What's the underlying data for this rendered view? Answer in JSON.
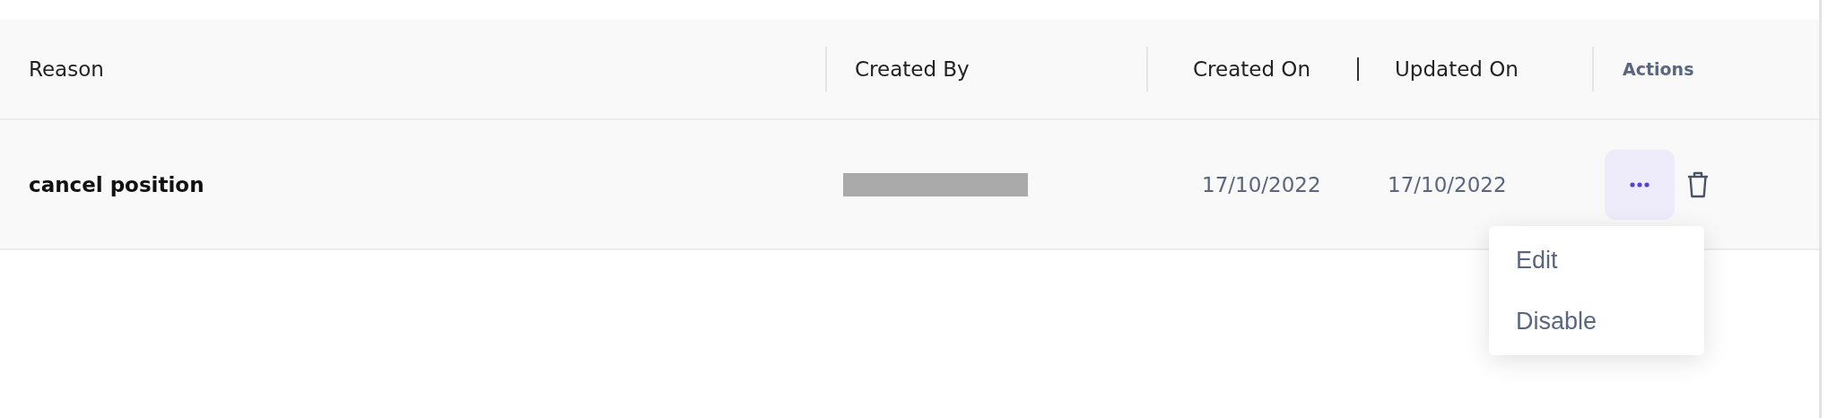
{
  "table": {
    "columns": [
      {
        "label": "Reason",
        "kind": "text"
      },
      {
        "label": "Created By",
        "kind": "text"
      },
      {
        "label": "Created On",
        "kind": "date"
      },
      {
        "label": "Updated On",
        "kind": "date"
      },
      {
        "label": "Actions",
        "kind": "actions"
      }
    ],
    "rows": [
      {
        "reason": "cancel position",
        "created_by": {
          "redacted": true
        },
        "created_on": "17/10/2022",
        "updated_on": "17/10/2022",
        "menu_open": true
      }
    ]
  },
  "menu": {
    "items": [
      {
        "label": "Edit"
      },
      {
        "label": "Disable"
      }
    ]
  }
}
